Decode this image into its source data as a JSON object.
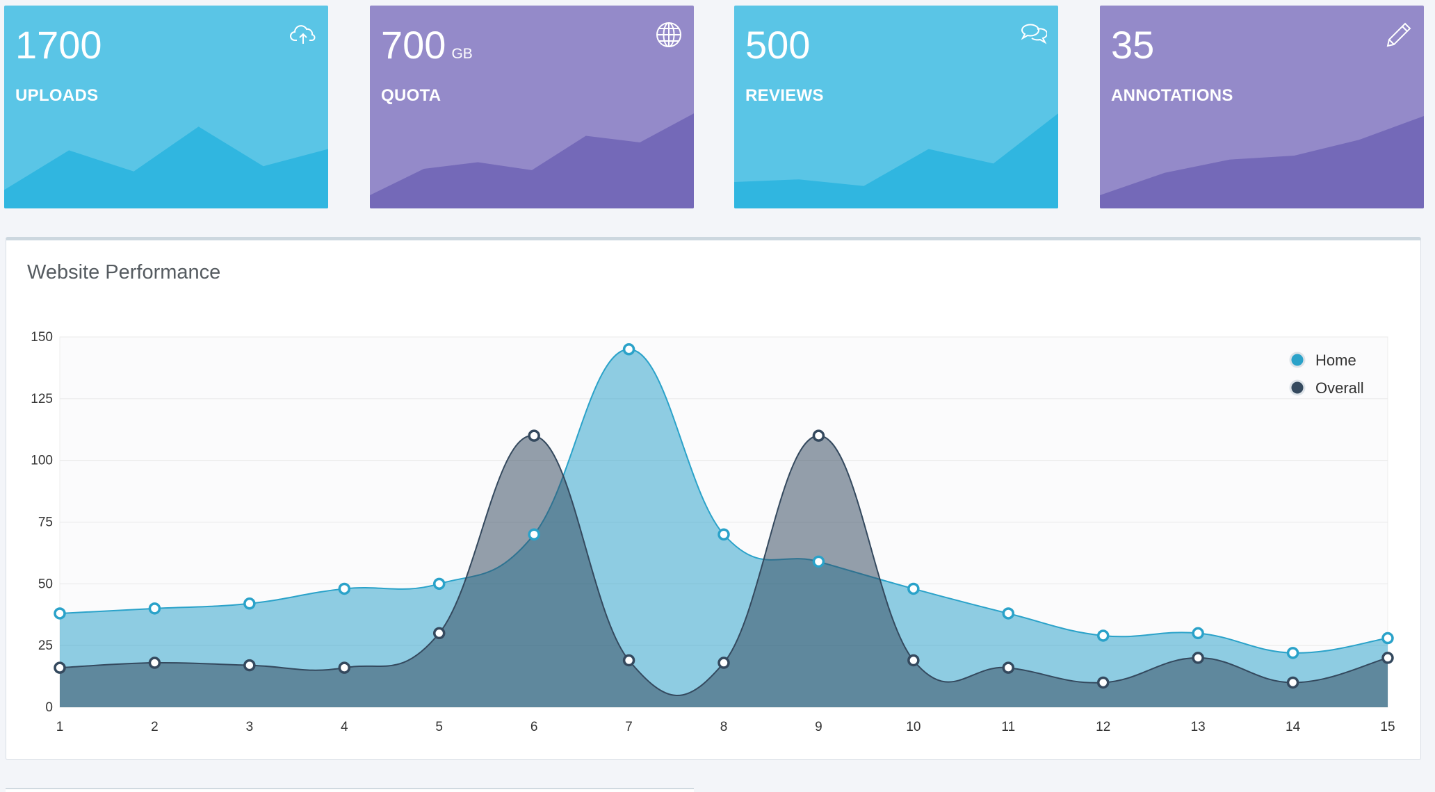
{
  "stats": [
    {
      "value": "1700",
      "unit": "",
      "label": "UPLOADS",
      "icon": "cloud-upload-icon",
      "bg": "#5ac5e6",
      "fg": "#30b6e0",
      "spark": [
        14,
        44,
        28,
        62,
        32,
        45
      ]
    },
    {
      "value": "700",
      "unit": "GB",
      "label": "QUOTA",
      "icon": "globe-icon",
      "bg": "#948ac9",
      "fg": "#7469b8",
      "spark": [
        10,
        30,
        35,
        29,
        55,
        50,
        72
      ]
    },
    {
      "value": "500",
      "unit": "",
      "label": "REVIEWS",
      "icon": "comments-icon",
      "bg": "#5ac5e6",
      "fg": "#30b6e0",
      "spark": [
        20,
        22,
        17,
        45,
        34,
        72
      ]
    },
    {
      "value": "35",
      "unit": "",
      "label": "ANNOTATIONS",
      "icon": "pencil-icon",
      "bg": "#948ac9",
      "fg": "#7469b8",
      "spark": [
        10,
        27,
        37,
        40,
        52,
        70
      ]
    }
  ],
  "performance": {
    "title": "Website Performance"
  },
  "chart_data": {
    "type": "area",
    "x": [
      1,
      2,
      3,
      4,
      5,
      6,
      7,
      8,
      9,
      10,
      11,
      12,
      13,
      14,
      15
    ],
    "series": [
      {
        "name": "Home",
        "values": [
          38,
          40,
          42,
          48,
          50,
          70,
          145,
          70,
          59,
          48,
          38,
          29,
          30,
          22,
          28
        ],
        "color": "#2aa2c9"
      },
      {
        "name": "Overall",
        "values": [
          16,
          18,
          17,
          16,
          30,
          110,
          19,
          18,
          110,
          19,
          16,
          10,
          20,
          10,
          20
        ],
        "color": "#34495e"
      }
    ],
    "ylim": [
      0,
      150
    ],
    "yticks": [
      0,
      25,
      50,
      75,
      100,
      125,
      150
    ],
    "xlabel": "",
    "ylabel": "",
    "grid": true,
    "legend": "top-right"
  }
}
